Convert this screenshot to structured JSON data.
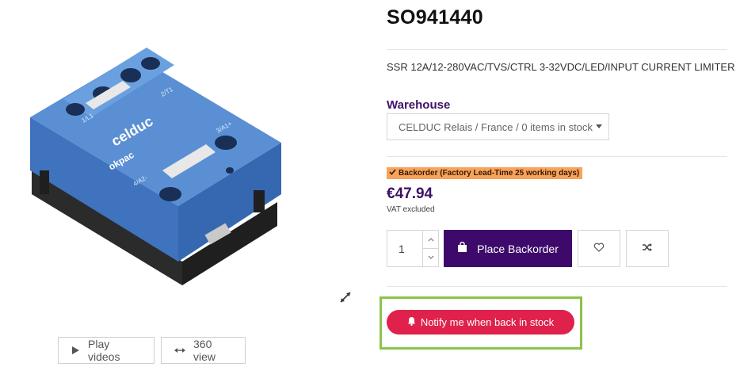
{
  "product": {
    "sku": "SO941440",
    "description": "SSR 12A/12-280VAC/TVS/CTRL 3-32VDC/LED/INPUT CURRENT LIMITER",
    "image_alt": "celduc okpac solid state relay",
    "image_text": {
      "brand": "celduc",
      "series": "okpac",
      "terminal_1": "1/L1",
      "terminal_2": "2/T1",
      "terminal_3": "3/A1+",
      "terminal_4": "4/A2-"
    }
  },
  "media": {
    "play_label": "Play videos",
    "view_label": "360 view"
  },
  "warehouse": {
    "label": "Warehouse",
    "selected": "CELDUC Relais / France / 0 items in stock"
  },
  "stock": {
    "badge": "Backorder (Factory Lead-Time 25 working days)",
    "badge_color": "#f7a35c"
  },
  "pricing": {
    "price": "€47.94",
    "vat_note": "VAT excluded"
  },
  "cart": {
    "quantity": "1",
    "place_label": "Place Backorder"
  },
  "notify": {
    "label": "Notify me when back in stock"
  },
  "colors": {
    "brand_purple": "#3d0a6b",
    "notify_red": "#e0214b",
    "highlight_green": "#8ac44a",
    "relay_blue": "#5b8fd4"
  },
  "icons": {
    "expand": "expand-arrows-icon",
    "play": "play-icon",
    "view360": "arrows-horizontal-icon",
    "bag": "shopping-bag-icon",
    "heart": "heart-icon",
    "shuffle": "shuffle-icon",
    "bell": "bell-icon",
    "check": "check-icon"
  }
}
